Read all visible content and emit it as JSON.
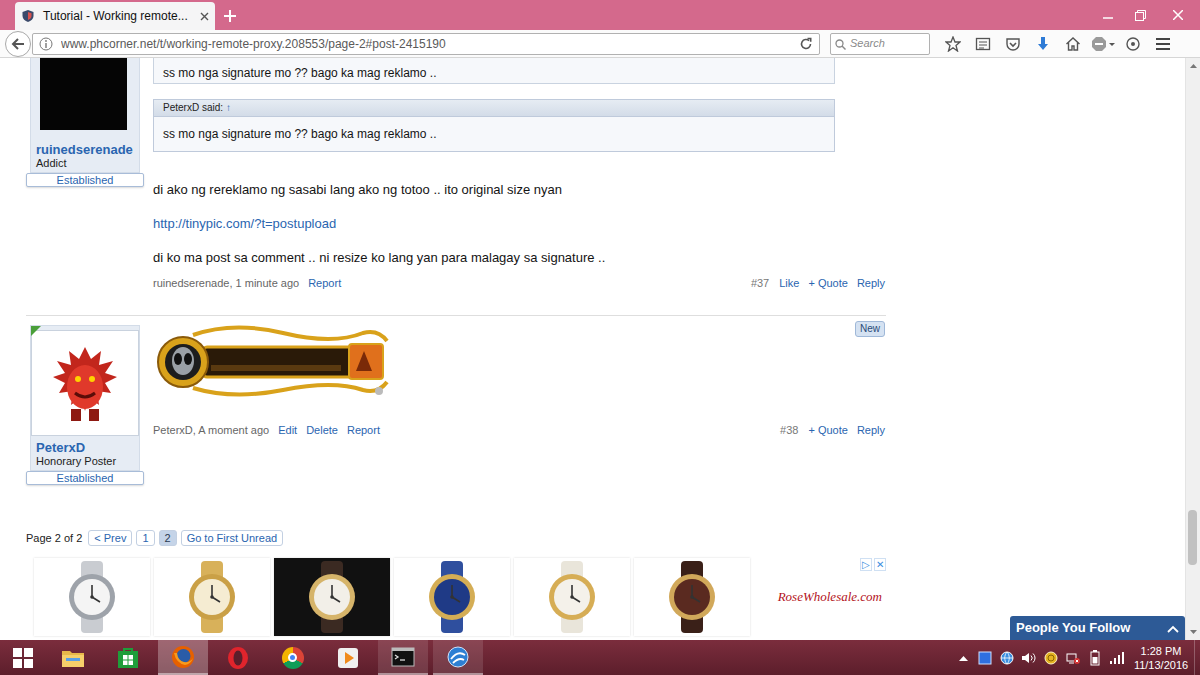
{
  "browser": {
    "tabs": [
      {
        "label": "Tutorial - Working remote...",
        "selected": true
      }
    ],
    "url": "www.phcorner.net/t/working-remote-proxy.208553/page-2#post-2415190",
    "search": {
      "placeholder": "Search"
    }
  },
  "page_scroll": {
    "level": 0.88
  },
  "posts": [
    {
      "user": {
        "name": "ruinedserenade",
        "title": "Addict",
        "badge": "Established",
        "online": false,
        "avatar": {
          "kind": "dark"
        }
      },
      "blocks": [
        {
          "kind": "quote-cut",
          "text": "ss mo nga signature mo ?? bago ka mag reklamo .."
        },
        {
          "kind": "quote",
          "author": "PeterxD said:",
          "arrow": "↑",
          "text": "ss mo nga signature mo ?? bago ka mag reklamo .."
        },
        {
          "kind": "text",
          "text": "di ako ng rereklamo ng sasabi lang ako ng totoo .. ito original size nyan"
        },
        {
          "kind": "link",
          "text": "http://tinypic.com/?t=postupload"
        },
        {
          "kind": "text",
          "text": "di ko ma post sa comment .. ni resize ko lang yan para malagay sa signature .."
        }
      ],
      "meta": "ruinedserenade, 1 minute ago",
      "actions_left": [
        "Report"
      ],
      "number": "#37",
      "actions_right": [
        "Like",
        "+ Quote",
        "Reply"
      ]
    },
    {
      "user": {
        "name": "PeterxD",
        "title": "Honorary Poster",
        "badge": "Established",
        "online": true,
        "avatar": {
          "kind": "monster"
        }
      },
      "badge": "New",
      "blocks": [
        {
          "kind": "image"
        }
      ],
      "meta": "PeterxD, A moment ago",
      "actions_left": [
        "Edit",
        "Delete",
        "Report"
      ],
      "number": "#38",
      "actions_right": [
        "+ Quote",
        "Reply"
      ]
    }
  ],
  "pagination": {
    "summary": "Page 2 of 2",
    "pages": [
      {
        "label": "< Prev",
        "selected": false
      },
      {
        "label": "1",
        "selected": false
      },
      {
        "label": "2",
        "selected": true
      }
    ],
    "first_unread": "Go to First Unread"
  },
  "ad": {
    "brand": "RoseWholesale.com",
    "choices": "▷",
    "close": "✕"
  },
  "follow": {
    "label": "People You Follow",
    "expanded": false
  },
  "taskbar": {
    "apps": [
      {
        "kind": "explorer",
        "open": false,
        "selected": false
      },
      {
        "kind": "store",
        "open": false,
        "selected": false
      },
      {
        "kind": "firefox",
        "open": true,
        "selected": true
      },
      {
        "kind": "opera",
        "open": false,
        "selected": false
      },
      {
        "kind": "chrome",
        "open": false,
        "selected": false
      },
      {
        "kind": "media",
        "open": false,
        "selected": false
      },
      {
        "kind": "cmd",
        "open": true,
        "selected": false
      },
      {
        "kind": "globe",
        "open": true,
        "selected": false
      }
    ],
    "time": "1:28 PM",
    "date": "11/13/2016"
  }
}
